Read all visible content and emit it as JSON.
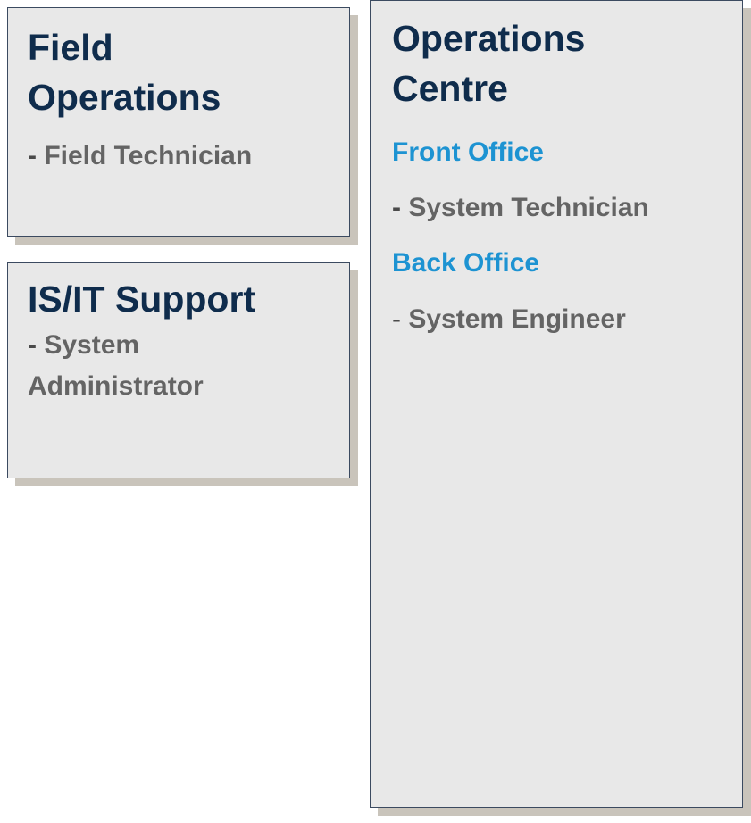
{
  "field_operations": {
    "title_line1": "Field",
    "title_line2": "Operations",
    "role_dash": "-",
    "role": " Field Technician"
  },
  "is_it_support": {
    "title": "IS/IT Support",
    "role_dash": "-",
    "role_line1": " System",
    "role_line2": "Administrator"
  },
  "operations_centre": {
    "title_line1": "Operations",
    "title_line2": "Centre",
    "front_office": {
      "label": "Front Office",
      "role_dash": "-",
      "role": " System Technician"
    },
    "back_office": {
      "label": "Back Office",
      "role_dash": "-",
      "role": " System Engineer"
    }
  },
  "colors": {
    "box_fill": "#e8e8e8",
    "box_border": "#3b4a60",
    "shadow": "#c9c4bb",
    "title": "#0f2c4c",
    "section": "#1d93d2",
    "role_text": "#646464"
  }
}
